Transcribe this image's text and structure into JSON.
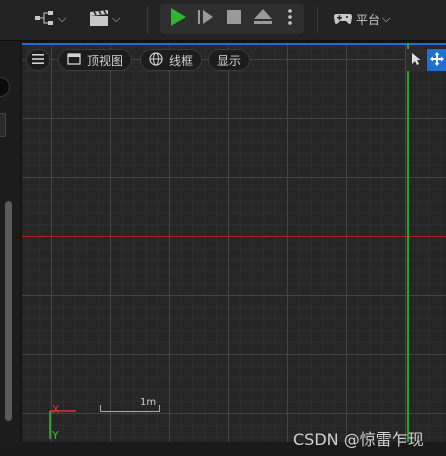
{
  "toolbar": {
    "platform_label": "平台"
  },
  "viewport_bar": {
    "view_label": "顶视图",
    "mode_label": "线框",
    "show_label": "显示"
  },
  "viewport": {
    "scale_label": "1m",
    "axis_x_label": "X",
    "axis_y_label": "Y"
  },
  "watermark": "CSDN @惊雷乍现",
  "colors": {
    "play_green": "#2fb52f",
    "axis_red": "#b02020",
    "axis_green": "#2aa52a",
    "selection_blue": "#1f6fd6"
  },
  "icons": [
    "hierarchy-icon",
    "clapper-icon",
    "play-icon",
    "step-icon",
    "stop-icon",
    "eject-icon",
    "more-icon",
    "gamepad-icon",
    "menu-icon",
    "window-icon",
    "globe-icon",
    "cursor-icon",
    "move-icon"
  ]
}
